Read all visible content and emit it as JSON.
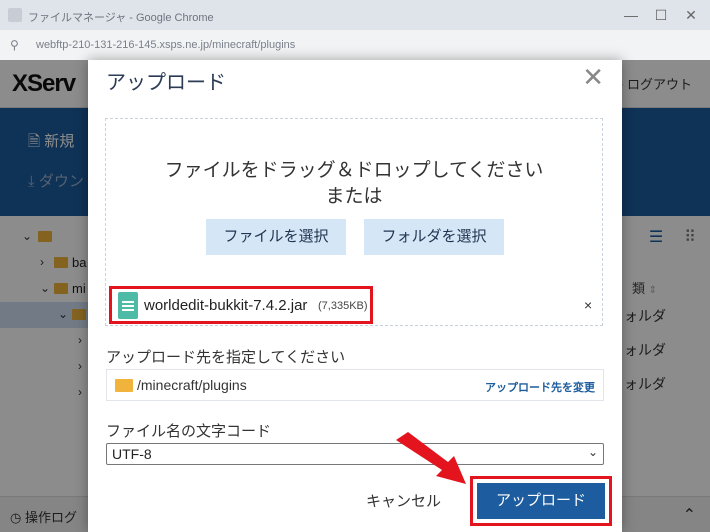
{
  "browser": {
    "window_title": "ファイルマネージャ - Google Chrome",
    "url": "webftp-210-131-216-145.xsps.ne.jp/minecraft/plugins"
  },
  "app": {
    "logo": "XServ",
    "logout": "ログアウト",
    "toolbar": {
      "new": "新規",
      "download": "ダウン"
    },
    "tree": [
      {
        "label": ""
      },
      {
        "label": "ba"
      },
      {
        "label": "mi"
      },
      {
        "label": ""
      },
      {
        "label": ""
      },
      {
        "label": ""
      },
      {
        "label": ""
      }
    ],
    "right_pane": {
      "column_header": "類",
      "cells": [
        "ォルダ",
        "ォルダ",
        "ォルダ"
      ]
    },
    "footer": {
      "log": "操作ログ"
    }
  },
  "modal": {
    "title": "アップロード",
    "dropzone": {
      "line1": "ファイルをドラッグ＆ドロップしてください",
      "line2": "または",
      "select_file": "ファイルを選択",
      "select_folder": "フォルダを選択"
    },
    "file": {
      "name": "worldedit-bukkit-7.4.2.jar",
      "size": "(7,335KB)",
      "remove": "×"
    },
    "destination": {
      "label": "アップロード先を指定してください",
      "path": "/minecraft/plugins",
      "change": "アップロード先を変更"
    },
    "encoding": {
      "label": "ファイル名の文字コード",
      "selected": "UTF-8"
    },
    "cancel": "キャンセル",
    "upload": "アップロード",
    "close": "✕"
  },
  "colors": {
    "accent": "#1d5c9e",
    "highlight": "#e3141e",
    "button_light": "#d5e6f6",
    "folder": "#f0b43c",
    "file_icon": "#4dbba6"
  }
}
